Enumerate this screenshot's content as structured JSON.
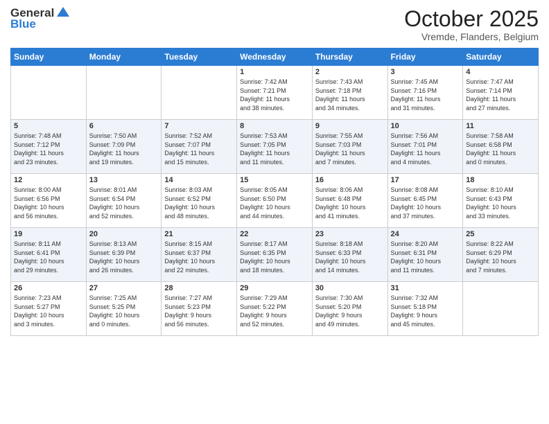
{
  "header": {
    "logo_line1": "General",
    "logo_line2": "Blue",
    "month_title": "October 2025",
    "location": "Vremde, Flanders, Belgium"
  },
  "weekdays": [
    "Sunday",
    "Monday",
    "Tuesday",
    "Wednesday",
    "Thursday",
    "Friday",
    "Saturday"
  ],
  "weeks": [
    [
      {
        "day": "",
        "info": ""
      },
      {
        "day": "",
        "info": ""
      },
      {
        "day": "",
        "info": ""
      },
      {
        "day": "1",
        "info": "Sunrise: 7:42 AM\nSunset: 7:21 PM\nDaylight: 11 hours\nand 38 minutes."
      },
      {
        "day": "2",
        "info": "Sunrise: 7:43 AM\nSunset: 7:18 PM\nDaylight: 11 hours\nand 34 minutes."
      },
      {
        "day": "3",
        "info": "Sunrise: 7:45 AM\nSunset: 7:16 PM\nDaylight: 11 hours\nand 31 minutes."
      },
      {
        "day": "4",
        "info": "Sunrise: 7:47 AM\nSunset: 7:14 PM\nDaylight: 11 hours\nand 27 minutes."
      }
    ],
    [
      {
        "day": "5",
        "info": "Sunrise: 7:48 AM\nSunset: 7:12 PM\nDaylight: 11 hours\nand 23 minutes."
      },
      {
        "day": "6",
        "info": "Sunrise: 7:50 AM\nSunset: 7:09 PM\nDaylight: 11 hours\nand 19 minutes."
      },
      {
        "day": "7",
        "info": "Sunrise: 7:52 AM\nSunset: 7:07 PM\nDaylight: 11 hours\nand 15 minutes."
      },
      {
        "day": "8",
        "info": "Sunrise: 7:53 AM\nSunset: 7:05 PM\nDaylight: 11 hours\nand 11 minutes."
      },
      {
        "day": "9",
        "info": "Sunrise: 7:55 AM\nSunset: 7:03 PM\nDaylight: 11 hours\nand 7 minutes."
      },
      {
        "day": "10",
        "info": "Sunrise: 7:56 AM\nSunset: 7:01 PM\nDaylight: 11 hours\nand 4 minutes."
      },
      {
        "day": "11",
        "info": "Sunrise: 7:58 AM\nSunset: 6:58 PM\nDaylight: 11 hours\nand 0 minutes."
      }
    ],
    [
      {
        "day": "12",
        "info": "Sunrise: 8:00 AM\nSunset: 6:56 PM\nDaylight: 10 hours\nand 56 minutes."
      },
      {
        "day": "13",
        "info": "Sunrise: 8:01 AM\nSunset: 6:54 PM\nDaylight: 10 hours\nand 52 minutes."
      },
      {
        "day": "14",
        "info": "Sunrise: 8:03 AM\nSunset: 6:52 PM\nDaylight: 10 hours\nand 48 minutes."
      },
      {
        "day": "15",
        "info": "Sunrise: 8:05 AM\nSunset: 6:50 PM\nDaylight: 10 hours\nand 44 minutes."
      },
      {
        "day": "16",
        "info": "Sunrise: 8:06 AM\nSunset: 6:48 PM\nDaylight: 10 hours\nand 41 minutes."
      },
      {
        "day": "17",
        "info": "Sunrise: 8:08 AM\nSunset: 6:45 PM\nDaylight: 10 hours\nand 37 minutes."
      },
      {
        "day": "18",
        "info": "Sunrise: 8:10 AM\nSunset: 6:43 PM\nDaylight: 10 hours\nand 33 minutes."
      }
    ],
    [
      {
        "day": "19",
        "info": "Sunrise: 8:11 AM\nSunset: 6:41 PM\nDaylight: 10 hours\nand 29 minutes."
      },
      {
        "day": "20",
        "info": "Sunrise: 8:13 AM\nSunset: 6:39 PM\nDaylight: 10 hours\nand 26 minutes."
      },
      {
        "day": "21",
        "info": "Sunrise: 8:15 AM\nSunset: 6:37 PM\nDaylight: 10 hours\nand 22 minutes."
      },
      {
        "day": "22",
        "info": "Sunrise: 8:17 AM\nSunset: 6:35 PM\nDaylight: 10 hours\nand 18 minutes."
      },
      {
        "day": "23",
        "info": "Sunrise: 8:18 AM\nSunset: 6:33 PM\nDaylight: 10 hours\nand 14 minutes."
      },
      {
        "day": "24",
        "info": "Sunrise: 8:20 AM\nSunset: 6:31 PM\nDaylight: 10 hours\nand 11 minutes."
      },
      {
        "day": "25",
        "info": "Sunrise: 8:22 AM\nSunset: 6:29 PM\nDaylight: 10 hours\nand 7 minutes."
      }
    ],
    [
      {
        "day": "26",
        "info": "Sunrise: 7:23 AM\nSunset: 5:27 PM\nDaylight: 10 hours\nand 3 minutes."
      },
      {
        "day": "27",
        "info": "Sunrise: 7:25 AM\nSunset: 5:25 PM\nDaylight: 10 hours\nand 0 minutes."
      },
      {
        "day": "28",
        "info": "Sunrise: 7:27 AM\nSunset: 5:23 PM\nDaylight: 9 hours\nand 56 minutes."
      },
      {
        "day": "29",
        "info": "Sunrise: 7:29 AM\nSunset: 5:22 PM\nDaylight: 9 hours\nand 52 minutes."
      },
      {
        "day": "30",
        "info": "Sunrise: 7:30 AM\nSunset: 5:20 PM\nDaylight: 9 hours\nand 49 minutes."
      },
      {
        "day": "31",
        "info": "Sunrise: 7:32 AM\nSunset: 5:18 PM\nDaylight: 9 hours\nand 45 minutes."
      },
      {
        "day": "",
        "info": ""
      }
    ]
  ]
}
